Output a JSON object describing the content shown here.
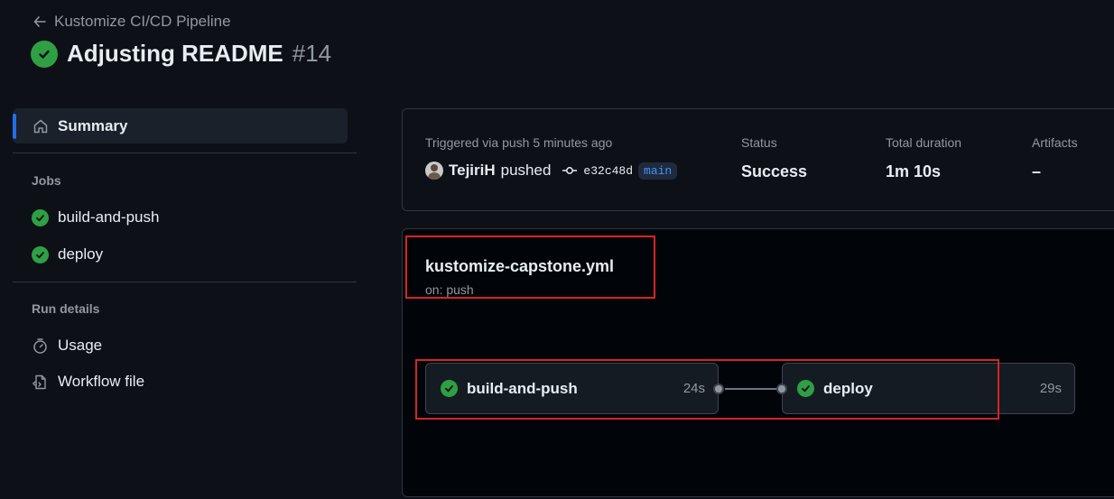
{
  "header": {
    "back_label": "Kustomize CI/CD Pipeline",
    "run_title": "Adjusting README",
    "run_number": "#14"
  },
  "sidebar": {
    "summary_label": "Summary",
    "jobs_heading": "Jobs",
    "jobs": [
      {
        "label": "build-and-push"
      },
      {
        "label": "deploy"
      }
    ],
    "run_details_heading": "Run details",
    "run_details": [
      {
        "label": "Usage",
        "icon": "stopwatch-icon"
      },
      {
        "label": "Workflow file",
        "icon": "file-code-icon"
      }
    ]
  },
  "summary": {
    "trigger_text": "Triggered via push 5 minutes ago",
    "actor": "TejiriH",
    "action": "pushed",
    "commit": "e32c48d",
    "branch": "main",
    "status_label": "Status",
    "status_value": "Success",
    "duration_label": "Total duration",
    "duration_value": "1m 10s",
    "artifacts_label": "Artifacts",
    "artifacts_value": "–"
  },
  "workflow": {
    "file_name": "kustomize-capstone.yml",
    "trigger": "on: push",
    "jobs": [
      {
        "name": "build-and-push",
        "duration": "24s"
      },
      {
        "name": "deploy",
        "duration": "29s"
      }
    ]
  },
  "colors": {
    "success": "#2ea043",
    "accent": "#1f6feb",
    "highlight": "#d52525"
  }
}
